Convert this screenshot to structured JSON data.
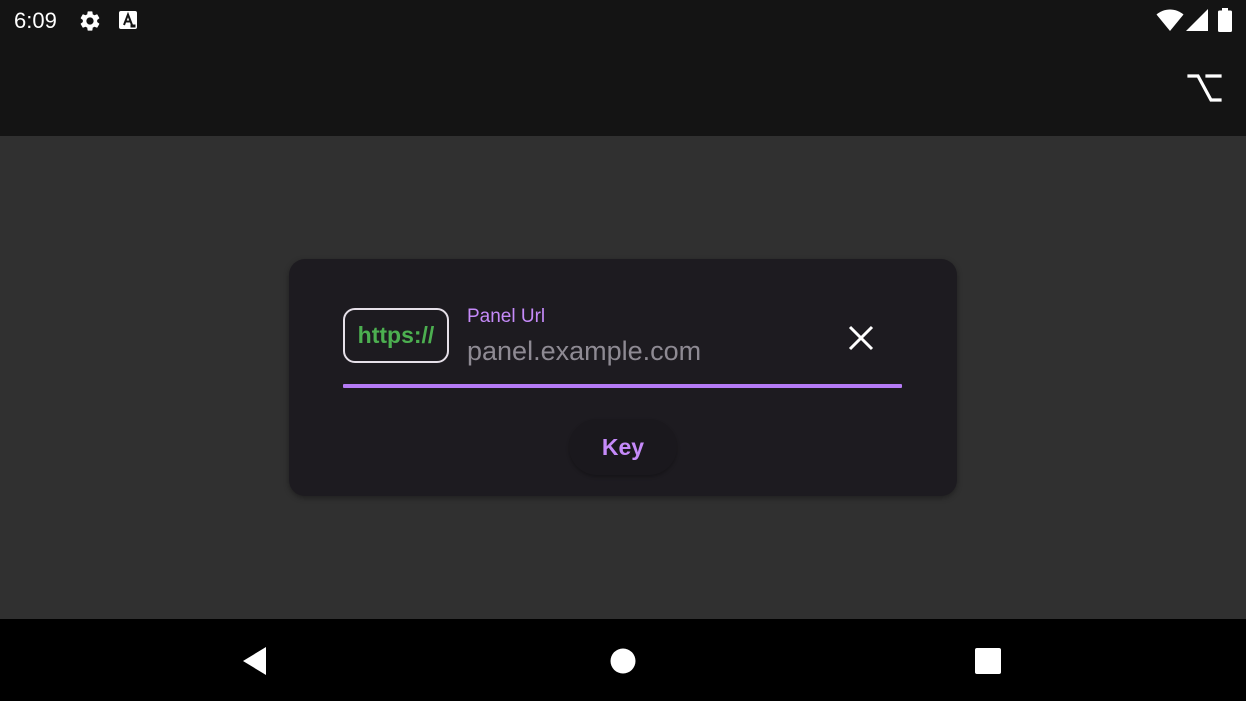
{
  "status_bar": {
    "time": "6:09",
    "left_icons": [
      "gear-icon",
      "keyboard-a-icon"
    ],
    "right_icons": [
      "wifi-icon",
      "cellular-signal-icon",
      "battery-icon"
    ]
  },
  "app_bar": {
    "action_icon": "option-key-icon"
  },
  "dialog": {
    "scheme": "https://",
    "field_label": "Panel Url",
    "url_value": "",
    "url_placeholder": "panel.example.com",
    "clear_icon": "close-icon",
    "key_button_label": "Key"
  },
  "nav_bar": {
    "items": [
      "back-icon",
      "home-icon",
      "recents-icon"
    ]
  },
  "colors": {
    "background": "#303030",
    "bar": "#141414",
    "dialog": "#1d1b20",
    "accent": "#c58af9",
    "scheme_green": "#4caf50"
  }
}
